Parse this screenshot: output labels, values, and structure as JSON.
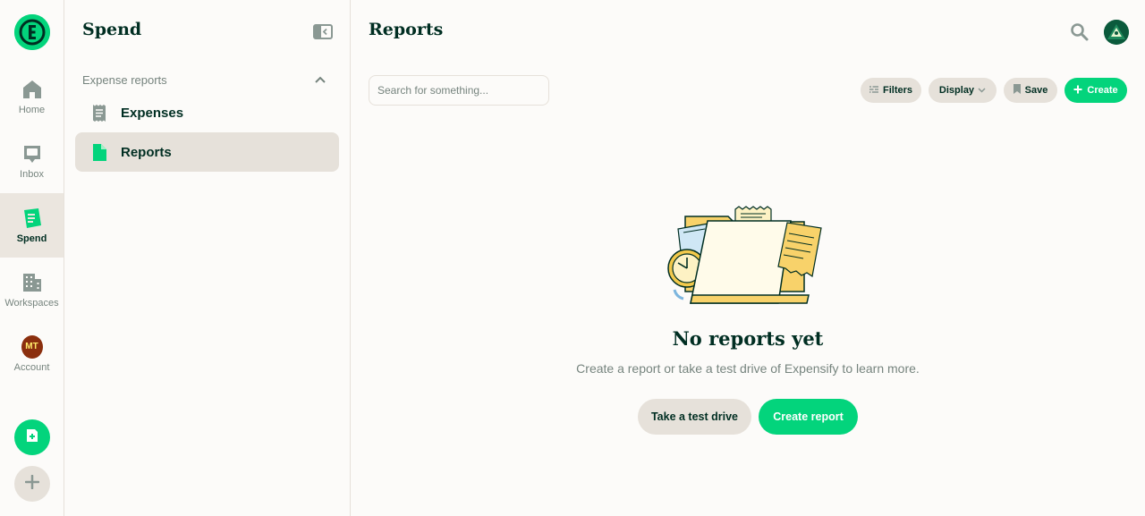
{
  "rail": {
    "items": [
      {
        "label": "Home",
        "icon": "home-icon"
      },
      {
        "label": "Inbox",
        "icon": "inbox-icon"
      },
      {
        "label": "Spend",
        "icon": "receipt-icon",
        "active": true
      },
      {
        "label": "Workspaces",
        "icon": "building-icon"
      },
      {
        "label": "Account",
        "icon": "avatar",
        "initials": "MT"
      }
    ],
    "logo_icon": "expensify-logo-icon",
    "fab_icons": [
      "new-expense-icon",
      "plus-icon"
    ]
  },
  "panel": {
    "title": "Spend",
    "section_label": "Expense reports",
    "items": [
      {
        "label": "Expenses",
        "icon": "receipt-icon"
      },
      {
        "label": "Reports",
        "icon": "document-icon",
        "active": true
      }
    ]
  },
  "main": {
    "title": "Reports",
    "search_placeholder": "Search for something...",
    "toolbar": {
      "filters": "Filters",
      "display": "Display",
      "save": "Save",
      "create": "Create"
    },
    "empty": {
      "title": "No reports yet",
      "subtitle": "Create a report or take a test drive of Expensify to learn more.",
      "test_drive": "Take a test drive",
      "create_report": "Create report"
    }
  },
  "colors": {
    "accent": "#03D47C",
    "text": "#002E22",
    "muted": "#76847E",
    "border": "#E6E1DA",
    "background": "#FCFBF9"
  }
}
